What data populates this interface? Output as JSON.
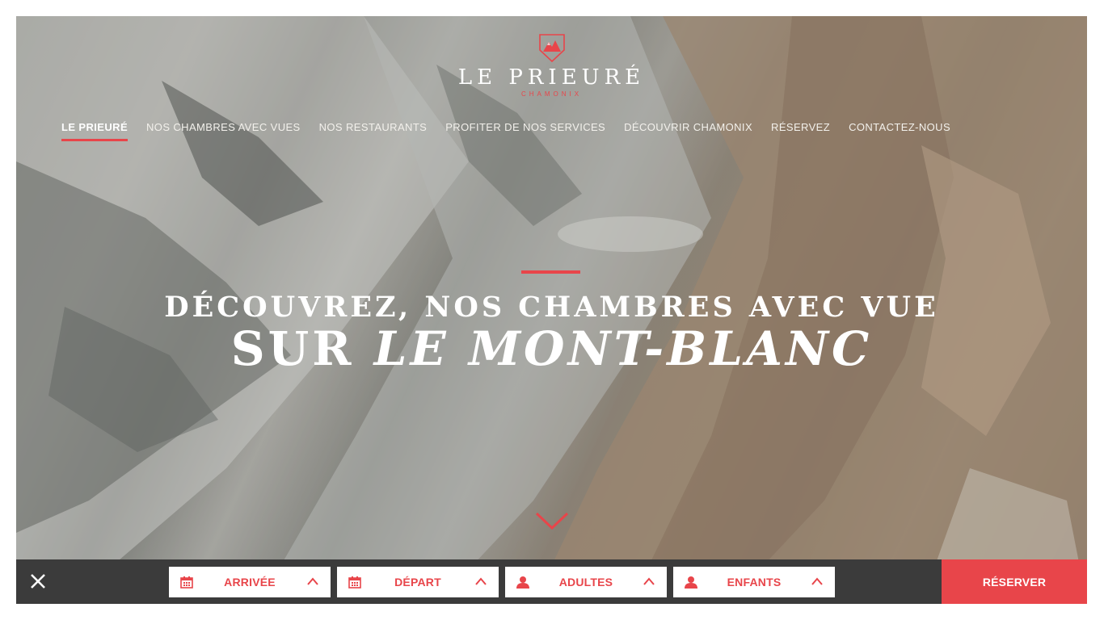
{
  "brand": {
    "name": "LE PRIEURÉ",
    "location": "CHAMONIX",
    "accent_color": "#e8454a"
  },
  "nav": {
    "items": [
      {
        "label": "LE PRIEURÉ",
        "active": true
      },
      {
        "label": "NOS CHAMBRES AVEC VUES"
      },
      {
        "label": "NOS RESTAURANTS"
      },
      {
        "label": "PROFITER DE NOS SERVICES"
      },
      {
        "label": "DÉCOUVRIR CHAMONIX"
      },
      {
        "label": "RÉSERVEZ"
      },
      {
        "label": "CONTACTEZ-NOUS"
      }
    ]
  },
  "hero": {
    "line1": "DÉCOUVREZ, NOS CHAMBRES AVEC VUE",
    "line2_prefix": "SUR ",
    "line2_emphasis": "LE MONT-BLANC"
  },
  "booking": {
    "fields": [
      {
        "label": "ARRIVÉE",
        "icon": "calendar-icon"
      },
      {
        "label": "DÉPART",
        "icon": "calendar-icon"
      },
      {
        "label": "ADULTES",
        "icon": "user-icon"
      },
      {
        "label": "ENFANTS",
        "icon": "user-icon"
      }
    ],
    "submit_label": "RÉSERVER",
    "bar_color": "#3b3b3b"
  }
}
